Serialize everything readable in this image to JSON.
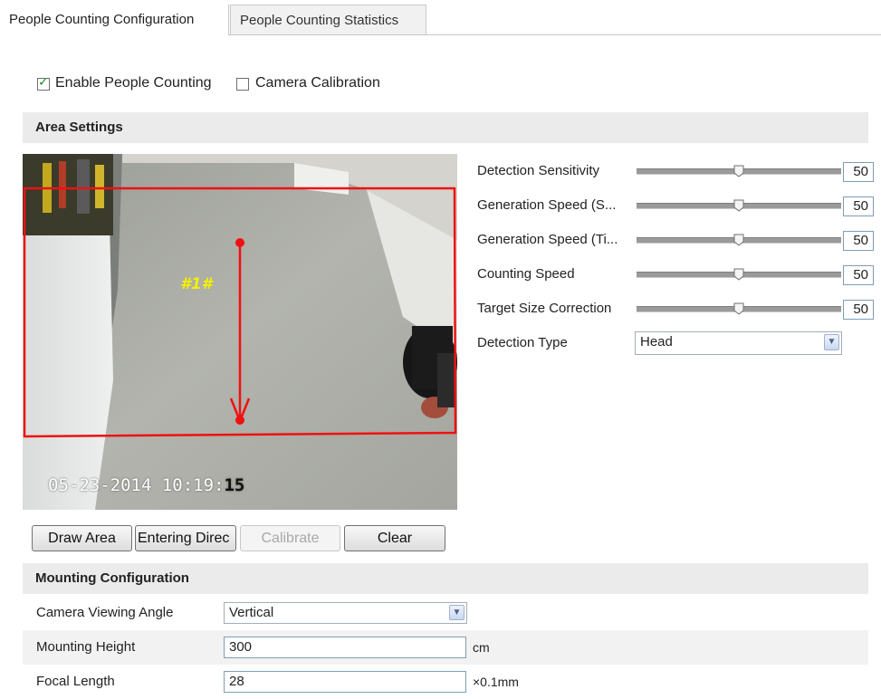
{
  "tabs": [
    {
      "label": "People Counting Configuration",
      "active": true
    },
    {
      "label": "People Counting Statistics",
      "active": false
    }
  ],
  "options": {
    "enable_people_counting": {
      "label": "Enable People Counting",
      "checked": true
    },
    "camera_calibration": {
      "label": "Camera Calibration",
      "checked": false
    }
  },
  "area_settings": {
    "title": "Area Settings",
    "video": {
      "area_label": "#1#",
      "timestamp_main": "05-23-2014 10:19:",
      "timestamp_seconds": "15"
    },
    "params": [
      {
        "label": "Detection Sensitivity",
        "value": "50"
      },
      {
        "label": "Generation Speed (S...",
        "value": "50"
      },
      {
        "label": "Generation Speed (Ti...",
        "value": "50"
      },
      {
        "label": "Counting Speed",
        "value": "50"
      },
      {
        "label": "Target Size Correction",
        "value": "50"
      }
    ],
    "detection_type": {
      "label": "Detection Type",
      "value": "Head"
    },
    "buttons": {
      "draw_area": "Draw Area",
      "entering_direction": "Entering Direc",
      "calibrate": "Calibrate",
      "clear": "Clear"
    }
  },
  "mounting": {
    "title": "Mounting Configuration",
    "viewing_angle": {
      "label": "Camera Viewing Angle",
      "value": "Vertical"
    },
    "mounting_height": {
      "label": "Mounting Height",
      "value": "300",
      "unit": "cm"
    },
    "focal_length": {
      "label": "Focal Length",
      "value": "28",
      "unit": "×0.1mm"
    }
  },
  "colors": {
    "area_outline": "#ee1111",
    "area_label": "#f3f000",
    "section_bg": "#ebebeb",
    "checkbox_check": "#2a8a2a"
  },
  "icons": {
    "dropdown_arrow": "chevron-down-icon",
    "slider_thumb": "slider-thumb-icon",
    "checkmark": "checkmark-icon"
  }
}
